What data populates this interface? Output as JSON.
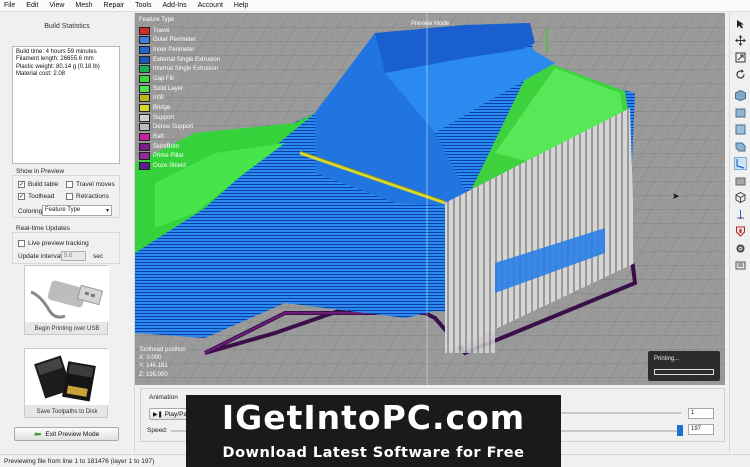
{
  "menu": [
    "File",
    "Edit",
    "View",
    "Mesh",
    "Repair",
    "Tools",
    "Add-Ins",
    "Account",
    "Help"
  ],
  "stats": {
    "title": "Build Statistics",
    "lines": [
      "Build time: 4 hours 59 minutes",
      "Filament length: 26655.6 mm",
      "Plastic weight: 80.14 g (0.18 lb)",
      "Material cost: 2.08"
    ]
  },
  "show_preview": {
    "label": "Show in Preview",
    "build_table": "Build table",
    "travel_moves": "Travel moves",
    "toolhead": "Toolhead",
    "retractions": "Retractions",
    "coloring_label": "Coloring",
    "coloring_value": "Feature Type",
    "build_table_checked": true,
    "travel_moves_checked": false,
    "toolhead_checked": true,
    "retractions_checked": false
  },
  "realtime": {
    "label": "Real-time Updates",
    "live_tracking": "Live preview tracking",
    "update_interval_label": "Update interval",
    "update_interval_value": "5.0",
    "unit": "sec",
    "live_tracking_checked": false
  },
  "cards": {
    "usb_label": "Begin Printing over USB",
    "sd_label": "Save Toolpaths to Disk"
  },
  "exit_button": "Exit Preview Mode",
  "viewport": {
    "legend_title": "Feature Type",
    "legend": [
      {
        "name": "Travel",
        "color": "#d42a2a"
      },
      {
        "name": "Outer Perimeter",
        "color": "#3f7fd9"
      },
      {
        "name": "Inner Perimeter",
        "color": "#2266cc"
      },
      {
        "name": "External Single Extrusion",
        "color": "#1a57b8"
      },
      {
        "name": "Internal Single Extrusion",
        "color": "#1bb05a"
      },
      {
        "name": "Gap Fill",
        "color": "#3ad93a"
      },
      {
        "name": "Solid Layer",
        "color": "#52e052"
      },
      {
        "name": "Infill",
        "color": "#b8b81e"
      },
      {
        "name": "Bridge",
        "color": "#d8d82a"
      },
      {
        "name": "Support",
        "color": "#cfcfcf"
      },
      {
        "name": "Dense Support",
        "color": "#bcbcbc"
      },
      {
        "name": "Raft",
        "color": "#c91f9e"
      },
      {
        "name": "Skirt/Brim",
        "color": "#7a1f8a"
      },
      {
        "name": "Prime Pillar",
        "color": "#8f2b96"
      },
      {
        "name": "Ooze Shield",
        "color": "#5b1e8a"
      }
    ],
    "preview_mode": "Preview Mode",
    "toolhead_label": "Toolhead position",
    "x": "X: 0.000",
    "y": "Y: 146.181",
    "z": "Z: 195.000",
    "printing": "Printing..."
  },
  "animation": {
    "label": "Animation",
    "play": "Play/Pa",
    "speed_label": "Speed:",
    "start_layer": "1",
    "end_layer": "197"
  },
  "status": "Previewing file from line 1 to 181476 (layer 1 to 197)",
  "watermark": {
    "title": "IGetIntoPC.com",
    "subtitle": "Download Latest Software for Free"
  }
}
